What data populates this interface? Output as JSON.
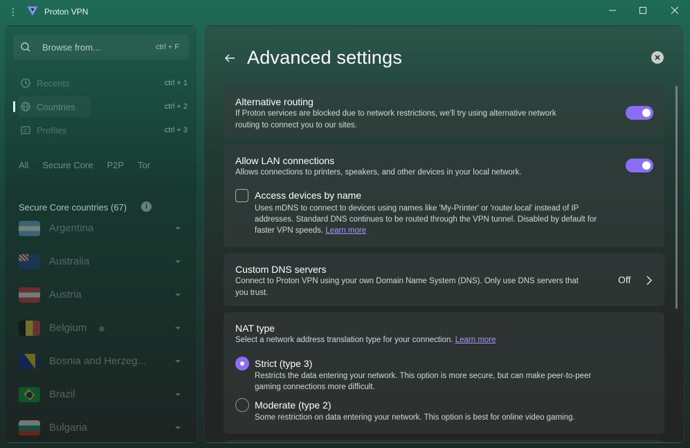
{
  "app": {
    "title": "Proton VPN"
  },
  "sidebar": {
    "search": {
      "placeholder": "Browse from...",
      "shortcut": "ctrl + F"
    },
    "nav": [
      {
        "label": "Recents",
        "shortcut": "ctrl + 1",
        "icon": "clock-icon"
      },
      {
        "label": "Countries",
        "shortcut": "ctrl + 2",
        "icon": "globe-icon",
        "active": true
      },
      {
        "label": "Profiles",
        "shortcut": "ctrl + 3",
        "icon": "profile-icon"
      }
    ],
    "filters": [
      "All",
      "Secure Core",
      "P2P",
      "Tor"
    ],
    "section_heading": "Secure Core countries (67)",
    "countries": [
      {
        "name": "Argentina"
      },
      {
        "name": "Australia"
      },
      {
        "name": "Austria"
      },
      {
        "name": "Belgium"
      },
      {
        "name": "Bosnia and Herzeg..."
      },
      {
        "name": "Brazil"
      },
      {
        "name": "Bulgaria"
      }
    ]
  },
  "main": {
    "title": "Advanced settings",
    "alt_routing": {
      "title": "Alternative routing",
      "desc_1": "If Proton services are blocked due to network restrictions, we'll try using alternative network",
      "desc_2": "routing to connect you to our sites.",
      "enabled": true
    },
    "lan": {
      "title": "Allow LAN connections",
      "desc": "Allows connections to printers, speakers, and other devices in your local network.",
      "enabled": true,
      "access_by_name": {
        "title": "Access devices by name",
        "desc_1": "Uses mDNS to connect to devices using names like 'My-Printer' or 'router.local' instead of IP",
        "desc_2": "addresses. Standard DNS continues to be routed through the VPN tunnel. Disabled by default for",
        "desc_3": "faster VPN speeds.",
        "link": "Learn more",
        "checked": false
      }
    },
    "dns": {
      "title": "Custom DNS servers",
      "desc_1": "Connect to Proton VPN using your own Domain Name System (DNS). Only use DNS servers that",
      "desc_2": "you trust.",
      "value": "Off"
    },
    "nat": {
      "title": "NAT type",
      "desc": "Select a network address translation type for your connection.",
      "link": "Learn more",
      "options": [
        {
          "label": "Strict (type 3)",
          "desc_1": "Restricts the data entering your network. This option is more secure, but can make peer-to-peer",
          "desc_2": "gaming connections more difficult.",
          "selected": true
        },
        {
          "label": "Moderate (type 2)",
          "desc_1": "Some restriction on data entering your network. This option is best for online video gaming.",
          "selected": false
        }
      ]
    }
  },
  "colors": {
    "accent": "#8a6ef5",
    "link": "#a996ff",
    "card": "#373e3c"
  }
}
